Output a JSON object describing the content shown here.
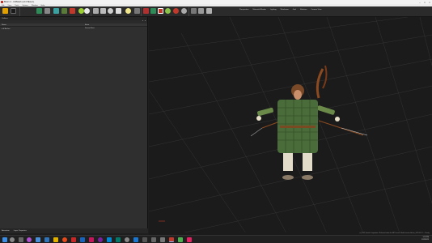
{
  "titlebar": {
    "title": "Biturn 2 - UI3Mesh (v2.0 Beta 1)"
  },
  "menu": [
    "File",
    "View",
    "Tools",
    "Options",
    "Window",
    "Help"
  ],
  "viewport_toolbar": [
    "Perspective",
    "Materials/Shader",
    "Lighting",
    "Wireframe",
    "Grid",
    "Skeleton",
    "Camera View"
  ],
  "outliner": {
    "title": "Outliner",
    "tabs": [
      "x",
      "x"
    ],
    "columns": {
      "name": "Name",
      "extra": "Extra"
    },
    "rows": [
      {
        "name": "▾ ⊞ Archer",
        "extra": "Scene Root"
      }
    ]
  },
  "left_footer": [
    "Animation",
    "Layer Properties"
  ],
  "status": {
    "text": "(c) 2023, Ideafix Corporation / Released under the MIT license. Model version: Archer_2025.03.12 — Ready."
  },
  "taskbar": {
    "time": "1:32 PM",
    "date": "3/12/2025"
  },
  "colors": {
    "accent": "#c0392b",
    "viewport_bg": "#1b1b1b",
    "panel_bg": "#2f2f2f"
  }
}
